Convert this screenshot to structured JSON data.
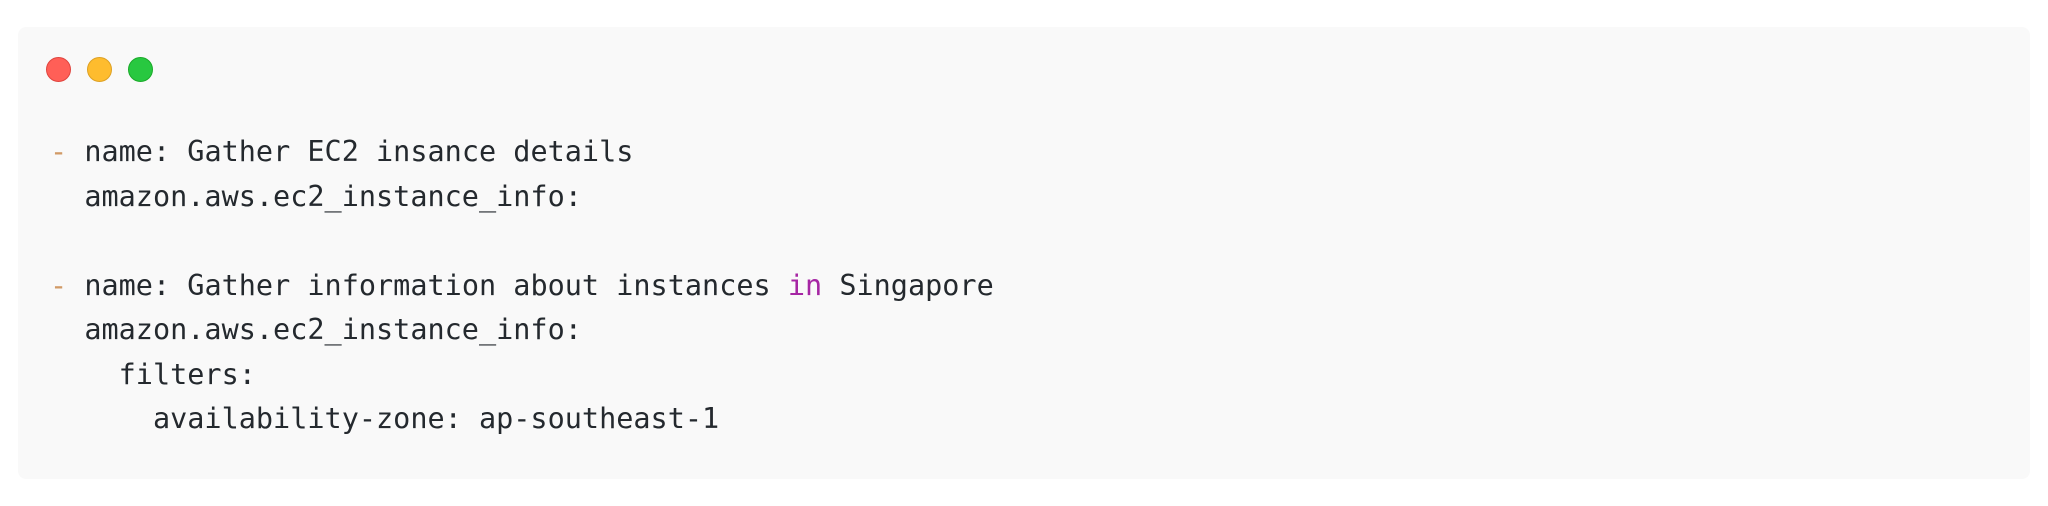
{
  "window": {
    "controls": {
      "close_color": "#ff5f57",
      "minimize_color": "#febc2e",
      "maximize_color": "#28c840"
    }
  },
  "code": {
    "language": "yaml",
    "colors": {
      "text": "#24292e",
      "dash": "#d19a66",
      "keyword": "#a626a4"
    },
    "lines": [
      {
        "dash": "-",
        "text": " name: Gather EC2 insance details"
      },
      {
        "text": "  amazon.aws.ec2_instance_info:"
      },
      {
        "text": ""
      },
      {
        "dash": "-",
        "text_before": " name: Gather information about instances ",
        "keyword": "in",
        "text_after": " Singapore"
      },
      {
        "text": "  amazon.aws.ec2_instance_info:"
      },
      {
        "text": "    filters:"
      },
      {
        "text": "      availability-zone: ap-southeast-1"
      }
    ]
  }
}
